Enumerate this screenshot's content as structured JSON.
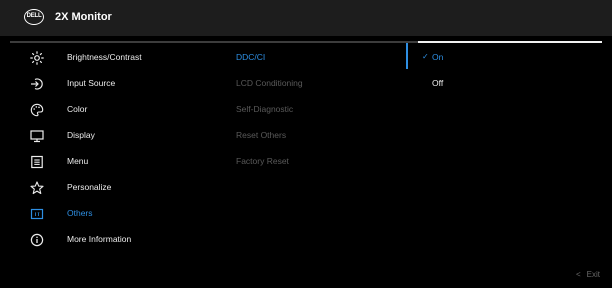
{
  "header": {
    "logo_text": "DELL",
    "title": "2X Monitor"
  },
  "menu": [
    {
      "label": "Brightness/Contrast",
      "icon": "brightness-icon"
    },
    {
      "label": "Input Source",
      "icon": "input-source-icon"
    },
    {
      "label": "Color",
      "icon": "color-palette-icon"
    },
    {
      "label": "Display",
      "icon": "display-icon"
    },
    {
      "label": "Menu",
      "icon": "menu-icon"
    },
    {
      "label": "Personalize",
      "icon": "star-icon"
    },
    {
      "label": "Others",
      "icon": "others-icon",
      "selected": true
    },
    {
      "label": "More Information",
      "icon": "info-icon"
    }
  ],
  "submenu": [
    {
      "label": "DDC/CI",
      "selected": true
    },
    {
      "label": "LCD Conditioning"
    },
    {
      "label": "Self-Diagnostic"
    },
    {
      "label": "Reset Others"
    },
    {
      "label": "Factory Reset"
    }
  ],
  "options": [
    {
      "label": "On",
      "checked": true
    },
    {
      "label": "Off"
    }
  ],
  "footer": {
    "exit_label": "Exit"
  },
  "colors": {
    "accent": "#2e8fe3",
    "header_bg": "#1d1d1d",
    "background": "#000000"
  }
}
